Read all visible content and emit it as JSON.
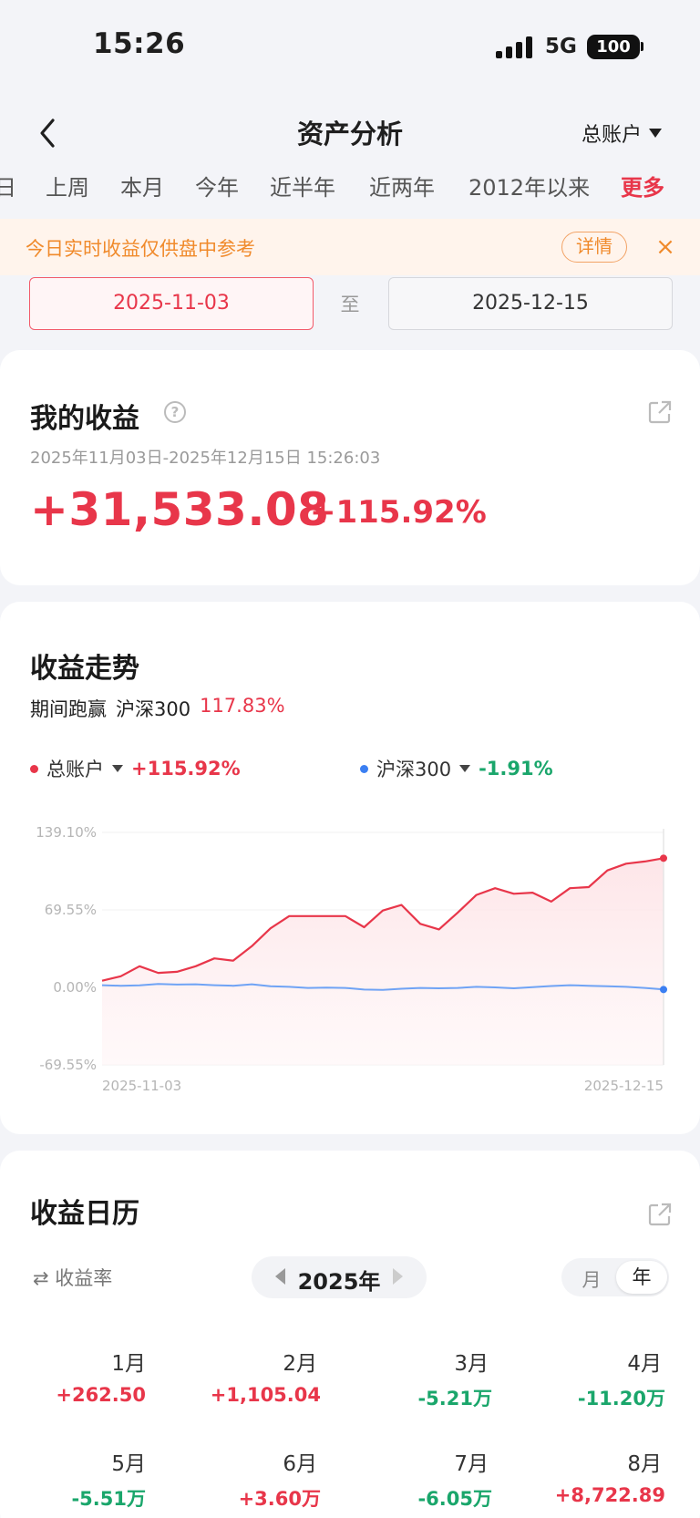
{
  "status": {
    "time": "15:26",
    "network": "5G",
    "battery": "100"
  },
  "nav": {
    "title": "资产分析",
    "account": "总账户"
  },
  "tabs": [
    {
      "label": "日",
      "active": false
    },
    {
      "label": "上周",
      "active": false
    },
    {
      "label": "本月",
      "active": false
    },
    {
      "label": "今年",
      "active": false
    },
    {
      "label": "近半年",
      "active": false
    },
    {
      "label": "近两年",
      "active": false
    },
    {
      "label": "2012年以来",
      "active": false
    },
    {
      "label": "更多",
      "active": true
    }
  ],
  "notice": {
    "text": "今日实时收益仅供盘中参考",
    "button": "详情",
    "close": "×"
  },
  "date_range": {
    "start": "2025-11-03",
    "sep": "至",
    "end": "2025-12-15"
  },
  "earnings": {
    "title": "我的收益",
    "period": "2025年11月03日-2025年12月15日 15:26:03",
    "amount": "+31,533.08",
    "pct": "+115.92%"
  },
  "trend": {
    "title": "收益走势",
    "beat_label": "期间跑赢",
    "beat_benchmark": "沪深300",
    "beat_value": "117.83%",
    "legend": [
      {
        "name": "总账户",
        "value": "+115.92%",
        "color": "#e8364a"
      },
      {
        "name": "沪深300",
        "value": "-1.91%",
        "color": "#3b7ff2"
      }
    ]
  },
  "chart_data": {
    "type": "line",
    "x_start_label": "2025-11-03",
    "x_end_label": "2025-12-15",
    "y_ticks": [
      "139.10%",
      "69.55%",
      "0.00%",
      "-69.55%"
    ],
    "ylim": [
      -69.55,
      139.1
    ],
    "grid": true,
    "legend_placement": "top",
    "series": [
      {
        "name": "总账户",
        "color": "#e8364a",
        "values": [
          6,
          10,
          19,
          13,
          14,
          19,
          26,
          24,
          37,
          53,
          64,
          64,
          64,
          64,
          54,
          69,
          74,
          57,
          52,
          67,
          83,
          89,
          84,
          85,
          77,
          89,
          90,
          105,
          111,
          113,
          115.92
        ]
      },
      {
        "name": "沪深300",
        "color": "#3b7ff2",
        "values": [
          2,
          1.5,
          1.8,
          3,
          2.5,
          2.8,
          2,
          1.5,
          2.8,
          1,
          0.5,
          -0.5,
          -0.2,
          -0.5,
          -2,
          -2.2,
          -1.2,
          -0.5,
          -0.8,
          -0.5,
          0.5,
          0,
          -0.8,
          0.2,
          1.2,
          2,
          1.5,
          1,
          0.5,
          -0.5,
          -1.91
        ]
      }
    ]
  },
  "calendar": {
    "title": "收益日历",
    "toggle": "收益率",
    "year": "2025年",
    "seg_month": "月",
    "seg_year": "年",
    "months": [
      {
        "label": "1月",
        "value": "+262.50",
        "sign": "pos"
      },
      {
        "label": "2月",
        "value": "+1,105.04",
        "sign": "pos"
      },
      {
        "label": "3月",
        "value": "-5.21万",
        "sign": "neg"
      },
      {
        "label": "4月",
        "value": "-11.20万",
        "sign": "neg"
      },
      {
        "label": "5月",
        "value": "-5.51万",
        "sign": "neg"
      },
      {
        "label": "6月",
        "value": "+3.60万",
        "sign": "pos"
      },
      {
        "label": "7月",
        "value": "-6.05万",
        "sign": "neg"
      },
      {
        "label": "8月",
        "value": "+8,722.89",
        "sign": "pos"
      }
    ]
  }
}
